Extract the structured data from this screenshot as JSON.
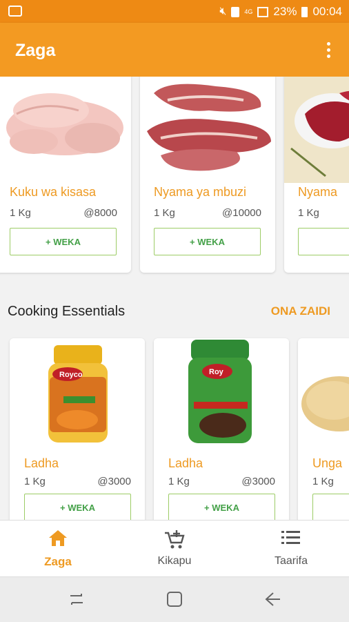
{
  "status_bar": {
    "battery": "23%",
    "time": "00:04",
    "network": "4G"
  },
  "app": {
    "title": "Zaga"
  },
  "meat_row": [
    {
      "name": "Kuku wa kisasa",
      "qty": "1 Kg",
      "price": "@8000",
      "button": "+ WEKA"
    },
    {
      "name": "Nyama ya mbuzi",
      "qty": "1 Kg",
      "price": "@10000",
      "button": "+ WEKA"
    },
    {
      "name": "Nyama",
      "qty": "1 Kg",
      "price": "",
      "button": "+"
    }
  ],
  "section": {
    "title": "Cooking Essentials",
    "see_more": "ONA ZAIDI"
  },
  "essentials_row": [
    {
      "name": "Ladha",
      "qty": "1 Kg",
      "price": "@3000",
      "button": "+ WEKA"
    },
    {
      "name": "Ladha",
      "qty": "1 Kg",
      "price": "@3000",
      "button": "+ WEKA"
    },
    {
      "name": "Unga",
      "qty": "1 Kg",
      "price": "",
      "button": ""
    }
  ],
  "bottom_nav": [
    {
      "label": "Zaga",
      "icon": "home-icon",
      "active": true
    },
    {
      "label": "Kikapu",
      "icon": "add-cart-icon",
      "active": false
    },
    {
      "label": "Taarifa",
      "icon": "list-icon",
      "active": false
    }
  ],
  "colors": {
    "status_bar": "#ee8a14",
    "app_bar": "#f39a22",
    "accent": "#ee9a22",
    "button_text": "#43a047",
    "button_border": "#9ccc65"
  }
}
